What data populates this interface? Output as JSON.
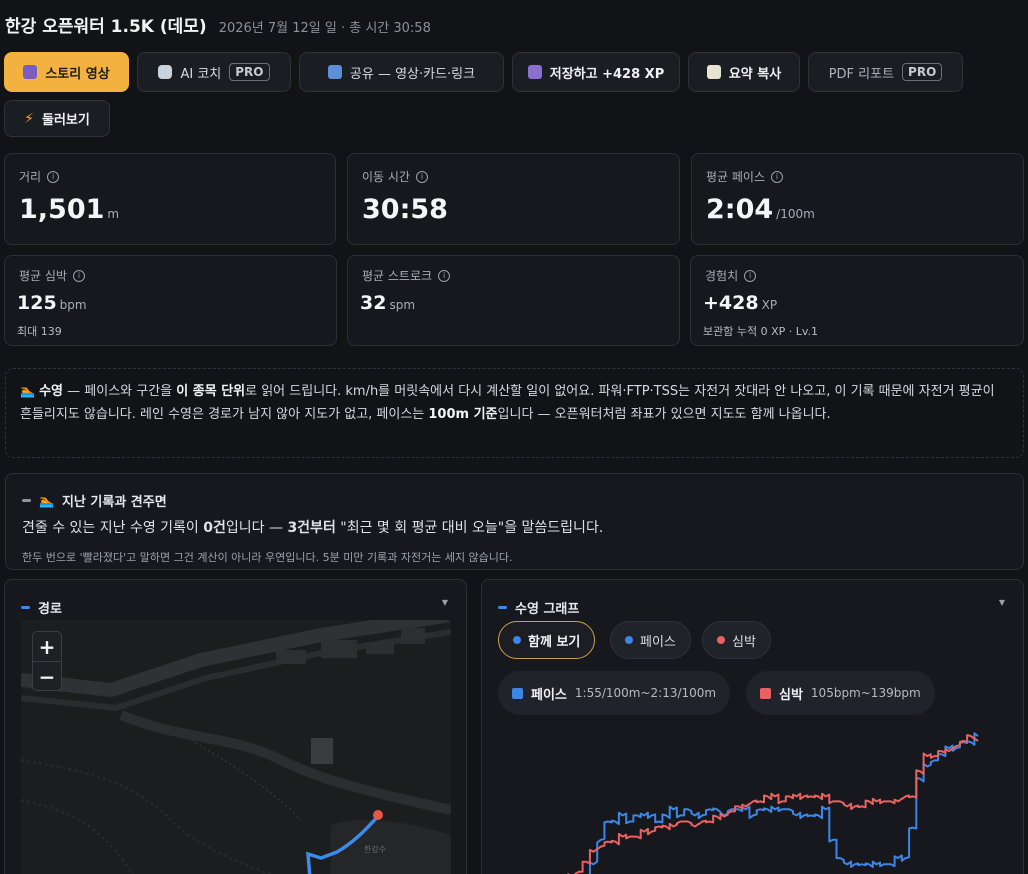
{
  "header": {
    "title": "한강 오픈워터 1.5K (데모)",
    "subtitle": "2026년 7월 12일 일 · 총 시간 30:58"
  },
  "toolbar": {
    "story_video": "스토리 영상",
    "ai_coach": "AI 코치",
    "ai_coach_badge": "PRO",
    "share": "공유 — 영상·카드·링크",
    "save_xp": "저장하고 +428 XP",
    "copy_summary": "요약 복사",
    "pdf_report": "PDF 리포트",
    "pdf_badge": "PRO",
    "browse": "둘러보기"
  },
  "stats": {
    "distance": {
      "label": "거리",
      "value": "1,501",
      "unit": "m"
    },
    "moving_time": {
      "label": "이동 시간",
      "value": "30:58",
      "unit": ""
    },
    "avg_pace": {
      "label": "평균 페이스",
      "value": "2:04",
      "unit": "/100m"
    },
    "avg_hr": {
      "label": "평균 심박",
      "value": "125",
      "unit": "bpm",
      "sub": "최대 139"
    },
    "avg_stroke": {
      "label": "평균 스트로크",
      "value": "32",
      "unit": "spm"
    },
    "xp": {
      "label": "경험치",
      "value": "+428",
      "unit": "XP",
      "sub": "보관함 누적 0 XP · Lv.1"
    }
  },
  "note": {
    "sport": "수영",
    "t1": " — 페이스와 구간을 ",
    "b1": "이 종목 단위",
    "t2": "로 읽어 드립니다. km/h를 머릿속에서 다시 계산할 일이 없어요. 파워·FTP·TSS는 자전거 잣대라 안 나오고, 이 기록 때문에 자전거 평균이 흔들리지도 않습니다. 레인 수영은 경로가 남지 않아 지도가 없고, 페이스는 ",
    "b2": "100m 기준",
    "t3": "입니다 — 오픈워터처럼 좌표가 있으면 지도도 함께 나옵니다."
  },
  "history": {
    "title": "지난 기록과 견주면",
    "line_a": "견줄 수 있는 지난 수영 기록이 ",
    "line_b": "0건",
    "line_c": "입니다 — ",
    "line_d": "3건부터",
    "line_e": " \"최근 몇 회 평균 대비 오늘\"을 말씀드립니다.",
    "footnote": "한두 번으로 '빨라졌다'고 말하면 그건 계산이 아니라 우연입니다. 5분 미만 기록과 자전거는 세지 않습니다."
  },
  "route": {
    "title": "경로",
    "zoom_in": "+",
    "zoom_out": "−",
    "map_label": "한강수"
  },
  "graph": {
    "title": "수영 그래프",
    "tabs": [
      "함께 보기",
      "페이스",
      "심박"
    ],
    "pace_legend": {
      "name": "페이스",
      "range": "1:55/100m~2:13/100m"
    },
    "hr_legend": {
      "name": "심박",
      "range": "105bpm~139bpm"
    }
  },
  "colors": {
    "accent": "#f3b13f",
    "pace": "#3d86e6",
    "heart": "#e86262",
    "route": "#3b8beb"
  },
  "chart_data": {
    "type": "line",
    "x_label": "",
    "series": [
      {
        "name": "페이스",
        "color": "#3d86e6",
        "values": [
          2.13,
          2.12,
          2.12,
          2.11,
          2.1,
          2.09,
          2.06,
          2.02,
          1.99,
          1.99,
          1.98,
          1.99,
          1.98,
          1.98,
          1.98,
          1.99,
          1.98,
          1.97,
          1.98,
          1.97,
          1.98,
          1.98,
          1.97,
          1.97,
          1.98,
          1.97,
          1.97,
          1.97,
          1.98,
          1.97,
          1.97,
          1.97,
          1.97,
          1.97,
          1.98,
          1.98,
          1.98,
          1.98,
          1.97,
          2.02,
          2.05,
          2.06,
          2.06,
          2.06,
          2.06,
          2.06,
          2.06,
          2.06,
          2.05,
          2.05,
          2.0,
          1.92,
          1.9,
          1.89,
          1.88,
          1.87,
          1.87,
          1.86,
          1.86,
          1.85
        ]
      },
      {
        "name": "심박",
        "color": "#e86262",
        "values": [
          105,
          107,
          109,
          111,
          112,
          114,
          116,
          117,
          118,
          118,
          119,
          119,
          119,
          120,
          120,
          121,
          121,
          121,
          122,
          122,
          121,
          122,
          122,
          123,
          123,
          124,
          125,
          125,
          126,
          126,
          127,
          127,
          126,
          127,
          127,
          127,
          127,
          127,
          127,
          126,
          126,
          125,
          125,
          125,
          126,
          126,
          126,
          126,
          126,
          127,
          127,
          132,
          135,
          135,
          136,
          136,
          137,
          138,
          139,
          138
        ]
      }
    ]
  }
}
